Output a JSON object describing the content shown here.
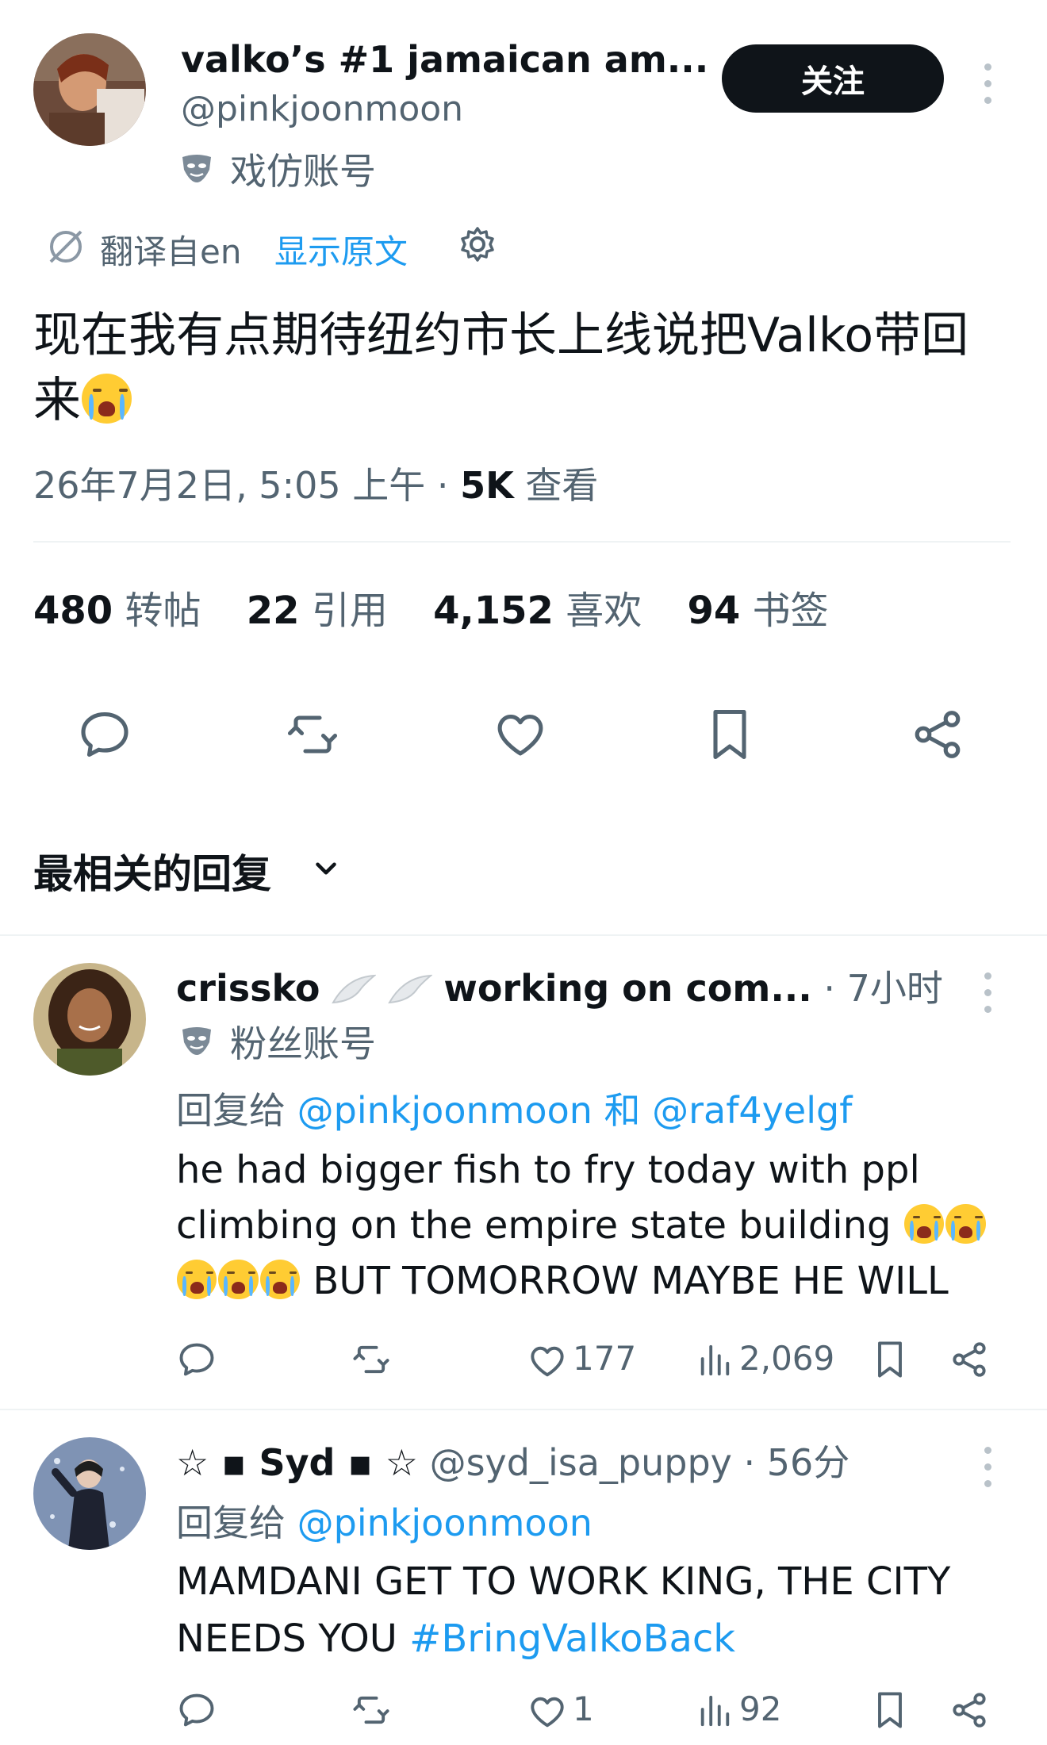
{
  "tweet": {
    "display_name": "valko’s #1 jamaican am...",
    "handle": "@pinkjoonmoon",
    "account_label": "戏仿账号",
    "follow_label": "关注",
    "translate_note": "翻译自en",
    "show_original": "显示原文",
    "text": "现在我有点期待纽约市长上线说把Valko带回来",
    "emoji": "loudly-crying-face",
    "date": "26年7月2日, 5:05 上午 · ",
    "views_count": "5K",
    "views_label": " 查看",
    "stats": [
      {
        "num": "480",
        "label": "转帖"
      },
      {
        "num": "22",
        "label": "引用"
      },
      {
        "num": "4,152",
        "label": "喜欢"
      },
      {
        "num": "94",
        "label": "书签"
      }
    ]
  },
  "replies_header": "最相关的回复",
  "replies": [
    {
      "display_name": "crissko",
      "name_suffix": "working on com...",
      "time": "· 7小时",
      "account_label": "粉丝账号",
      "reply_to_prefix": "回复给 ",
      "reply_to_user1": "@pinkjoonmoon",
      "reply_to_sep": " 和 ",
      "reply_to_user2": "@raf4yelgf",
      "text_line1": "he had bigger fish to fry today with ppl",
      "text_line2": "climbing on the empire state building",
      "text_line3": " BUT TOMORROW MAYBE HE WILL",
      "likes": "177",
      "views": "2,069"
    },
    {
      "display_name": "☆ ▪ Syd ▪ ☆",
      "handle_time": "@syd_isa_puppy · 56分",
      "reply_to_prefix": "回复给 ",
      "reply_to_user1": "@pinkjoonmoon",
      "text_line1": "MAMDANI GET TO WORK KING, THE CITY",
      "text_line2": "NEEDS YOU ",
      "hashtag": "#BringValkoBack",
      "likes": "1",
      "views": "92"
    }
  ],
  "colors": {
    "accent": "#1d9bf0",
    "text": "#0f1419",
    "muted": "#536471"
  }
}
